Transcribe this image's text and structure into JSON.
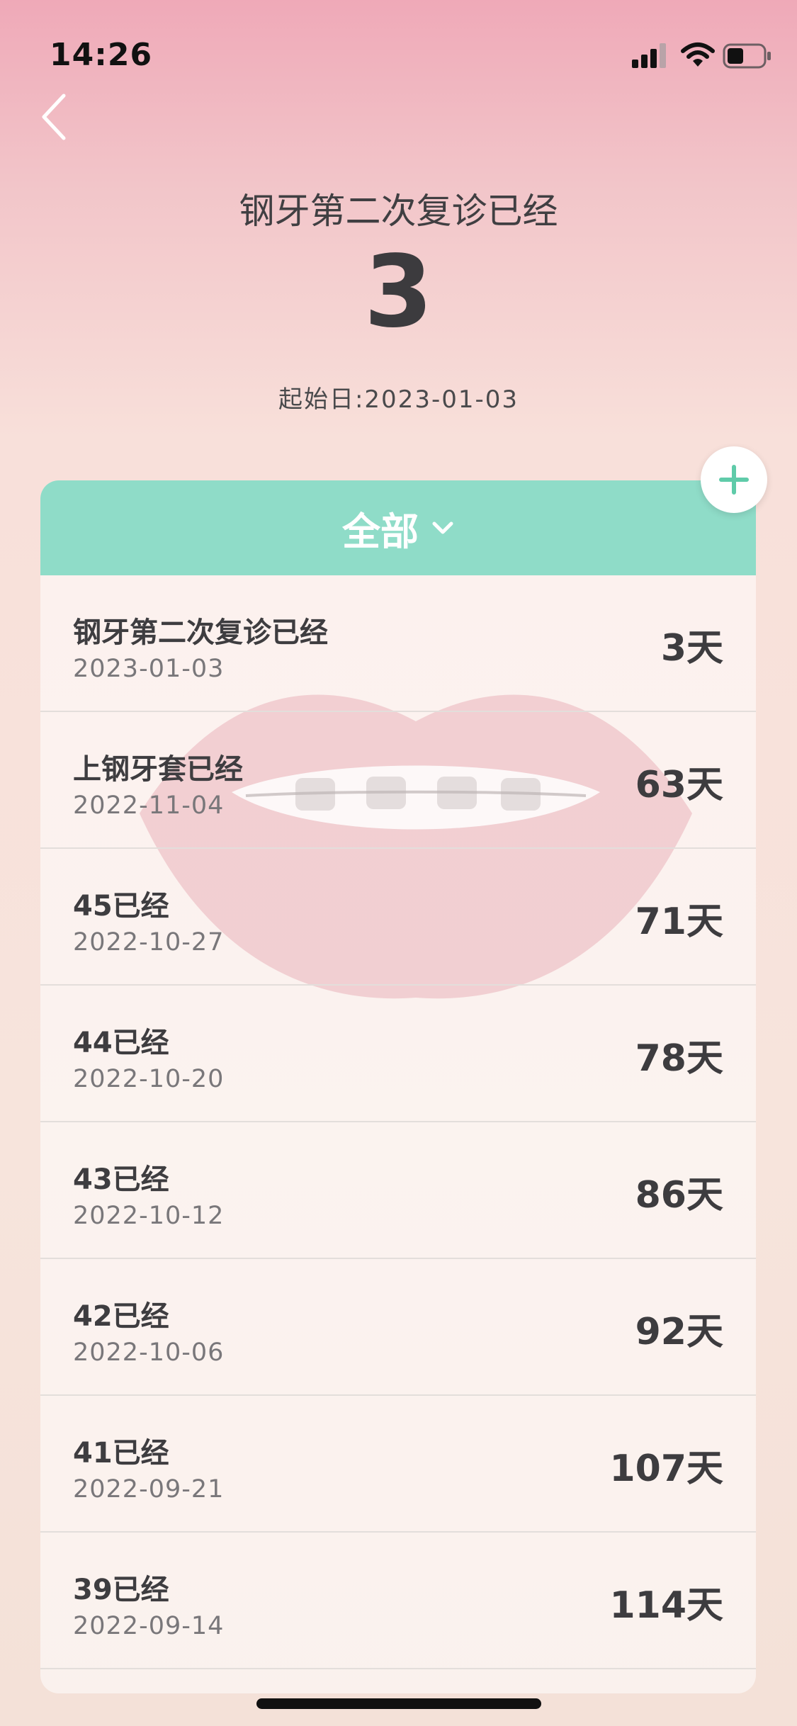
{
  "status_bar": {
    "time": "14:26",
    "signal_icon": "cellular-signal-icon",
    "wifi_icon": "wifi-icon",
    "battery_icon": "battery-icon"
  },
  "nav": {
    "back_icon": "chevron-left-icon"
  },
  "header": {
    "title": "钢牙第二次复诊已经",
    "count": "3",
    "start_date": "起始日:2023-01-03"
  },
  "card": {
    "filter_label": "全部",
    "filter_icon": "chevron-down-icon",
    "add_icon": "plus-icon",
    "items": [
      {
        "title": "钢牙第二次复诊已经",
        "date": "2023-01-03",
        "days": "3天"
      },
      {
        "title": "上钢牙套已经",
        "date": "2022-11-04",
        "days": "63天"
      },
      {
        "title": "45已经",
        "date": "2022-10-27",
        "days": "71天"
      },
      {
        "title": "44已经",
        "date": "2022-10-20",
        "days": "78天"
      },
      {
        "title": "43已经",
        "date": "2022-10-12",
        "days": "86天"
      },
      {
        "title": "42已经",
        "date": "2022-10-06",
        "days": "92天"
      },
      {
        "title": "41已经",
        "date": "2022-09-21",
        "days": "107天"
      },
      {
        "title": "39已经",
        "date": "2022-09-14",
        "days": "114天"
      }
    ]
  },
  "colors": {
    "accent": "#8fdcc8",
    "plus": "#5fcba9",
    "text": "#3c3b3e"
  }
}
